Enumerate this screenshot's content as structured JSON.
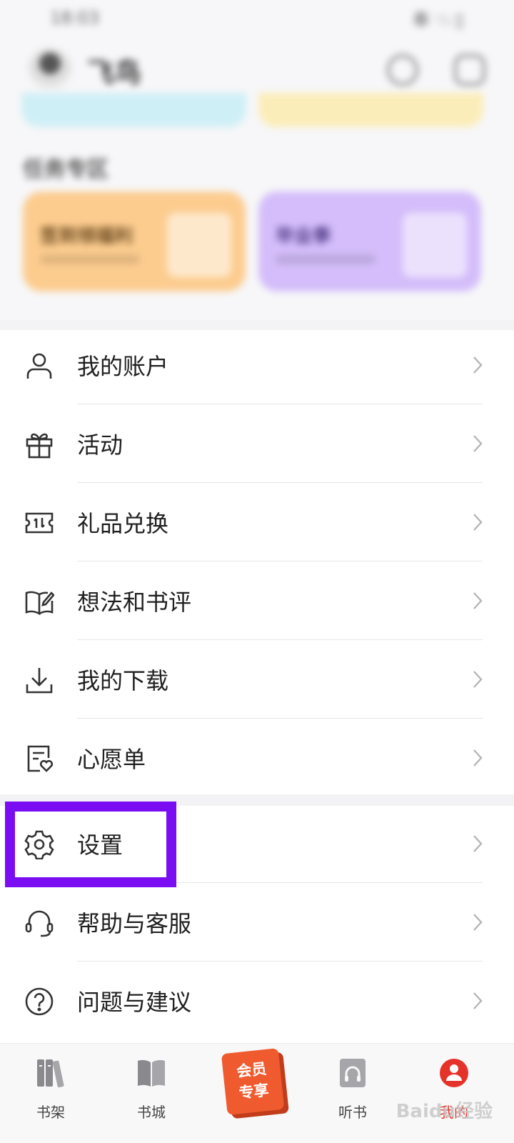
{
  "status_bar": {
    "time": "18:03",
    "indicators": "奉 ∵ᵢ ▯"
  },
  "header": {
    "user_name": "飞鸟",
    "search_icon": "search-icon",
    "message_icon": "message-icon"
  },
  "task_section": {
    "title": "任务专区",
    "cards": [
      {
        "title": "签到领福利",
        "color": "#fccc8f"
      },
      {
        "title": "毕业季",
        "color": "#d4bdfa"
      }
    ]
  },
  "menu": {
    "group1": [
      {
        "label": "我的账户",
        "icon": "user-icon"
      },
      {
        "label": "活动",
        "icon": "gift-icon"
      },
      {
        "label": "礼品兑换",
        "icon": "ticket-icon"
      },
      {
        "label": "想法和书评",
        "icon": "book-edit-icon"
      },
      {
        "label": "我的下载",
        "icon": "download-icon"
      },
      {
        "label": "心愿单",
        "icon": "wishlist-icon"
      }
    ],
    "group2": [
      {
        "label": "设置",
        "icon": "gear-icon"
      },
      {
        "label": "帮助与客服",
        "icon": "headset-icon"
      },
      {
        "label": "问题与建议",
        "icon": "question-icon"
      }
    ]
  },
  "highlight_color": "#7a0df2",
  "bottom_nav": {
    "items": [
      {
        "label": "书架",
        "icon": "bookshelf-icon"
      },
      {
        "label": "书城",
        "icon": "bookstore-icon"
      },
      {
        "label": "听书",
        "icon": "audiobook-icon"
      },
      {
        "label": "我的",
        "icon": "profile-icon",
        "active": true
      }
    ],
    "vip": {
      "line1": "会员",
      "line2": "专享"
    }
  },
  "watermark": "Baidu经验"
}
